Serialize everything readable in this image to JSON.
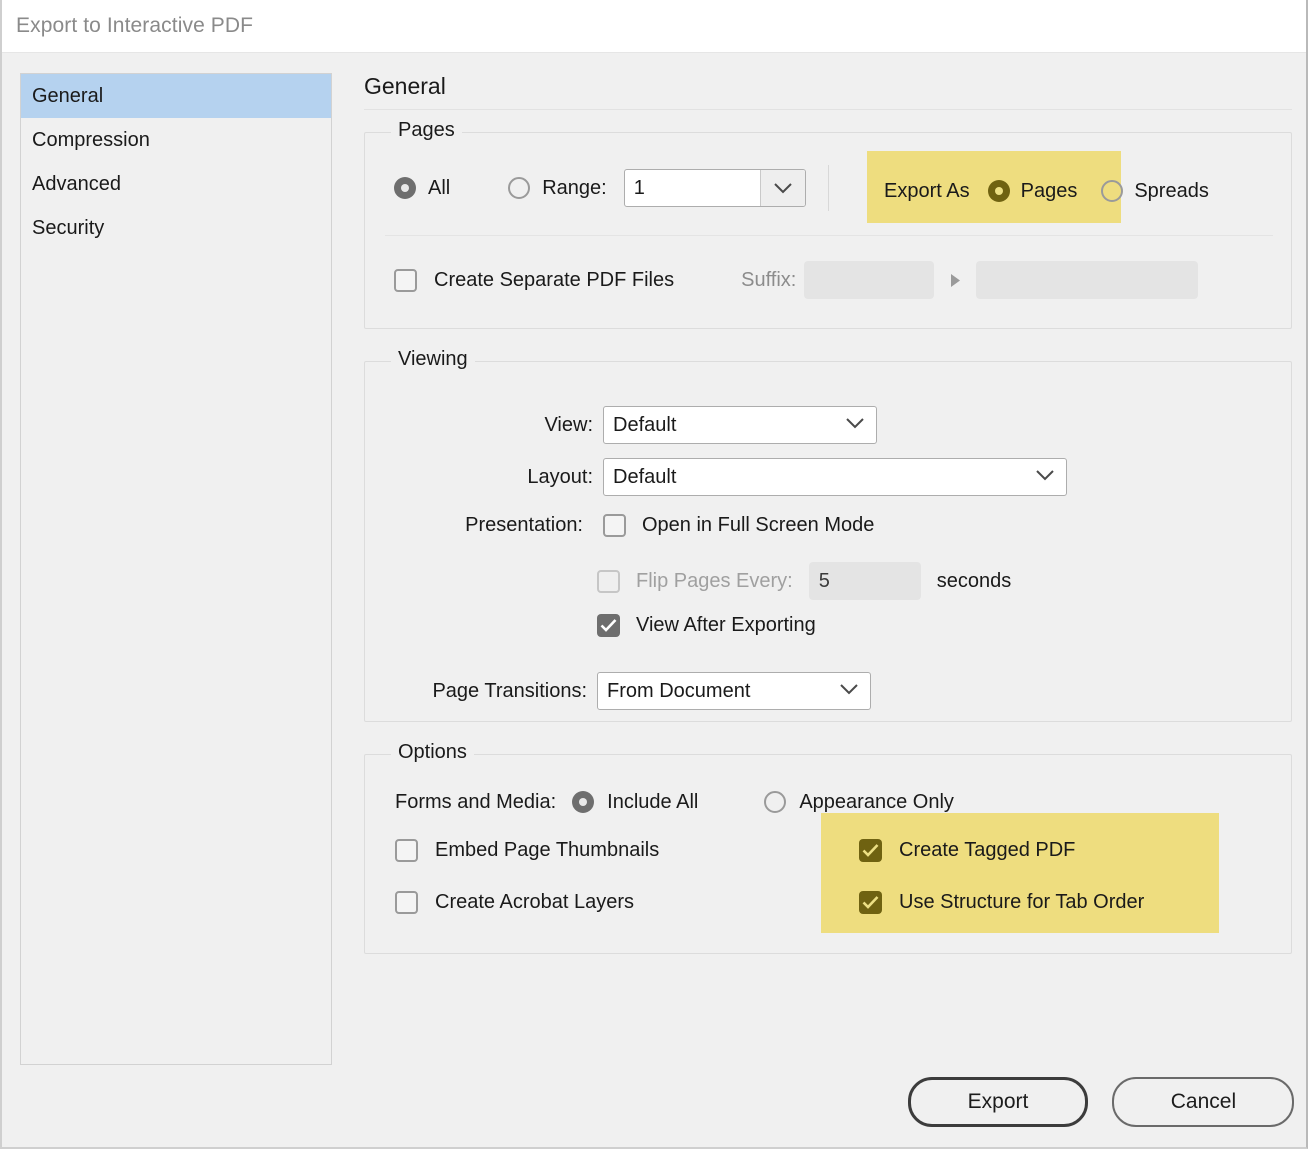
{
  "window": {
    "title": "Export to Interactive PDF"
  },
  "sidebar": {
    "items": [
      {
        "label": "General"
      },
      {
        "label": "Compression"
      },
      {
        "label": "Advanced"
      },
      {
        "label": "Security"
      }
    ]
  },
  "pane": {
    "title": "General"
  },
  "pages_group": {
    "title": "Pages",
    "all_label": "All",
    "range_label": "Range:",
    "range_value": "1",
    "export_as_label": "Export As",
    "pages_label": "Pages",
    "spreads_label": "Spreads",
    "create_separate_label": "Create Separate PDF Files",
    "suffix_label": "Suffix:",
    "suffix_value": "",
    "suffix_preview_value": ""
  },
  "viewing_group": {
    "title": "Viewing",
    "view_label": "View:",
    "view_value": "Default",
    "layout_label": "Layout:",
    "layout_value": "Default",
    "presentation_label": "Presentation:",
    "full_screen_label": "Open in Full Screen Mode",
    "flip_pages_label": "Flip Pages Every:",
    "flip_pages_value": "5",
    "seconds_label": "seconds",
    "view_after_exporting_label": "View After Exporting",
    "page_transitions_label": "Page Transitions:",
    "page_transitions_value": "From Document"
  },
  "options_group": {
    "title": "Options",
    "forms_media_label": "Forms and Media:",
    "include_all_label": "Include All",
    "appearance_only_label": "Appearance Only",
    "embed_thumbnails_label": "Embed Page Thumbnails",
    "create_acrobat_layers_label": "Create Acrobat Layers",
    "create_tagged_pdf_label": "Create Tagged PDF",
    "use_structure_tab_order_label": "Use Structure for Tab Order"
  },
  "footer": {
    "export_label": "Export",
    "cancel_label": "Cancel"
  },
  "colors": {
    "highlight": "#eedd7f",
    "selection": "#b5d2ef",
    "dialog_bg": "#f0f0f0",
    "olive_control": "#6f6211"
  }
}
